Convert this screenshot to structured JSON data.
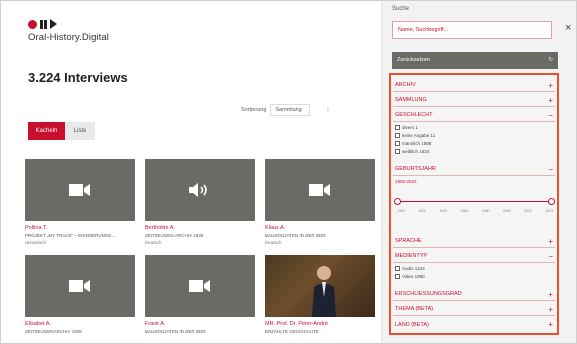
{
  "app": {
    "logo_text": "Oral-History.Digital"
  },
  "main": {
    "result_count": "3.224 Interviews",
    "sort": {
      "label": "Sortierung",
      "value": "Sammlung",
      "arrow": "↕"
    },
    "view": {
      "tiles_label": "Kacheln",
      "list_label": "Liste"
    }
  },
  "cards": [
    {
      "title": "Pollina T.",
      "project": "PROJEKT „MY TRACE\" – ERINNERUNGE…",
      "language": "Ukrainisch",
      "media": "video"
    },
    {
      "title": "Bertholde A.",
      "project": "ZEITZEUGEN-ARCHIV 1939",
      "language": "Deutsch",
      "media": "audio"
    },
    {
      "title": "Klaus A.",
      "project": "BAUSOLDATEN IN DER DDR",
      "language": "Deutsch",
      "media": "video"
    },
    {
      "title": "Elisabet A.",
      "project": "ZEITZEUGENARCHIV 1945",
      "language": "",
      "media": "video"
    },
    {
      "title": "Frank A.",
      "project": "BAUSOLDATEN IN DER DDR",
      "language": "",
      "media": "video"
    },
    {
      "title": "MR. Prof. Dr. Peter-André",
      "project": "ERZÄHLTE GESCHICHTE",
      "language": "",
      "media": "photo"
    }
  ],
  "sidebar": {
    "search_label": "Suche",
    "search_placeholder": "Name, Suchbegriff...",
    "close_symbol": "×",
    "reset_label": "Zurücksetzen",
    "reset_symbol": "↻",
    "facets": {
      "archiv": "ARCHIV",
      "sammlung": "SAMMLUNG",
      "geschlecht": "GESCHLECHT",
      "geburtsjahr": "GEBURTSJAHR",
      "sprache": "SPRACHE",
      "medientyp": "MEDIENTYP",
      "erschliessung": "ERSCHLIESSUNGSGRAD",
      "thema": "THEMA (BETA)",
      "land": "LAND (BETA)"
    },
    "gender_options": [
      "divers 1",
      "keine Angabe 11",
      "männlich 1588",
      "weiblich 1624"
    ],
    "year_range": "1900-2023",
    "slider_ticks": [
      "1900",
      "1920",
      "1940",
      "1960",
      "1980",
      "2000",
      "2010",
      "2023"
    ],
    "media_options": [
      "Audio 1244",
      "Video 1980"
    ],
    "symbols": {
      "expand": "+",
      "collapse": "−"
    }
  },
  "colors": {
    "accent": "#c8102e",
    "panel_border": "#e8502e",
    "thumb_bg": "#6b6b65"
  }
}
